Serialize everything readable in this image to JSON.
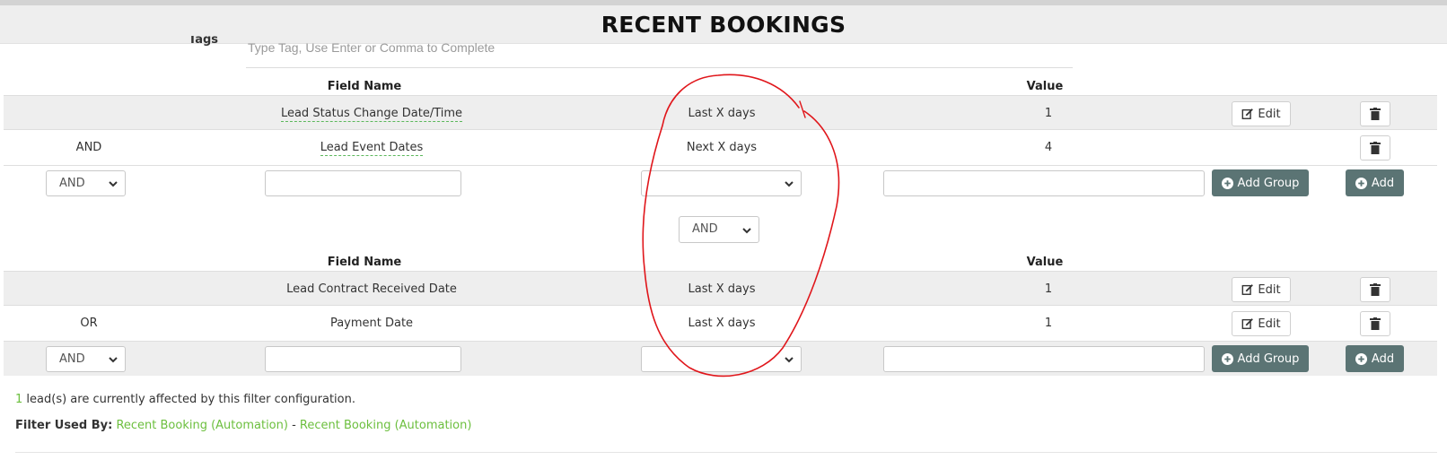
{
  "header": {
    "title": "RECENT BOOKINGS"
  },
  "tags": {
    "label": "Tags",
    "placeholder": "Type Tag, Use Enter or Comma to Complete"
  },
  "groups": [
    {
      "headers": {
        "field_name": "Field Name",
        "value": "Value"
      },
      "rows": [
        {
          "connector": "",
          "field": "Lead Status Change Date/Time",
          "operator": "Last X days",
          "value": "1",
          "edit_label": "Edit"
        },
        {
          "connector": "AND",
          "field": "Lead Event Dates",
          "operator": "Next X days",
          "value": "4",
          "edit_label": ""
        }
      ],
      "new_row": {
        "connector": "AND",
        "add_group_label": "Add Group",
        "add_label": "Add"
      }
    },
    {
      "headers": {
        "field_name": "Field Name",
        "value": "Value"
      },
      "rows": [
        {
          "connector": "",
          "field": "Lead Contract Received Date",
          "operator": "Last X days",
          "value": "1",
          "edit_label": "Edit"
        },
        {
          "connector": "OR",
          "field": "Payment Date",
          "operator": "Last X days",
          "value": "1",
          "edit_label": "Edit"
        }
      ],
      "new_row": {
        "connector": "AND",
        "add_group_label": "Add Group",
        "add_label": "Add"
      }
    }
  ],
  "group_connector": "AND",
  "summary": {
    "count": "1",
    "affected_text": " lead(s) are currently affected by this filter configuration.",
    "used_by_label": "Filter Used By:",
    "used_by": [
      "Recent Booking (Automation)",
      "Recent Booking (Automation)"
    ],
    "separator": " - "
  },
  "colors": {
    "accent_green": "#6cbf3e",
    "button_dark": "#5b7474",
    "annotation_red": "#e0161b"
  },
  "icons": {
    "edit": "edit-icon",
    "delete": "trash-icon",
    "add": "plus-circle-icon",
    "dropdown": "chevron-down-icon"
  }
}
